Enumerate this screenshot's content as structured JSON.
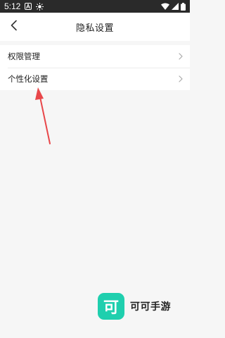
{
  "status_bar": {
    "time": "5:12",
    "icons": [
      "a-icon",
      "brightness-icon",
      "wifi-icon",
      "signal-icon",
      "battery-icon"
    ]
  },
  "header": {
    "title": "隐私设置",
    "back_icon": "chevron-left-icon"
  },
  "settings": {
    "items": [
      {
        "label": "权限管理",
        "icon": "chevron-right-icon"
      },
      {
        "label": "个性化设置",
        "icon": "chevron-right-icon"
      }
    ]
  },
  "annotation": {
    "color": "#e8474a"
  },
  "watermark": {
    "logo_char": "可",
    "text": "可可手游",
    "color": "#1fcfae"
  },
  "colors": {
    "background": "#f6f6f6",
    "status_bar": "#2a2a2a",
    "card": "#ffffff"
  }
}
